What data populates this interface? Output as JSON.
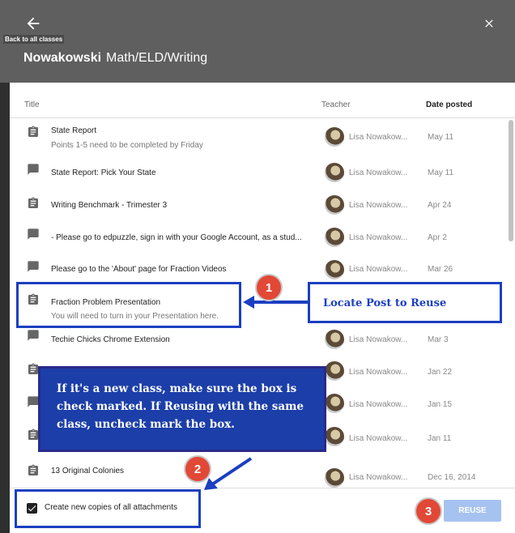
{
  "header": {
    "back_tooltip": "Back to all classes",
    "teacher_name": "Nowakowski",
    "class_name": "Math/ELD/Writing"
  },
  "columns": {
    "title": "Title",
    "teacher": "Teacher",
    "date": "Date posted"
  },
  "rows": [
    {
      "icon": "assignment-icon",
      "title": "State Report",
      "subtitle": "Points 1-5 need to be completed by Friday",
      "teacher": "Lisa Nowakow...",
      "date": "May 11"
    },
    {
      "icon": "announcement-icon",
      "title": "State Report: Pick Your State",
      "subtitle": "",
      "teacher": "Lisa Nowakow...",
      "date": "May 11"
    },
    {
      "icon": "assignment-icon",
      "title": "Writing Benchmark - Trimester 3",
      "subtitle": "",
      "teacher": "Lisa Nowakow...",
      "date": "Apr 24"
    },
    {
      "icon": "announcement-icon",
      "title": "- Please go to edpuzzle, sign in with your Google Account, as a stud...",
      "subtitle": "",
      "teacher": "Lisa Nowakow...",
      "date": "Apr 2"
    },
    {
      "icon": "announcement-icon",
      "title": "Please go to the 'About' page for Fraction Videos",
      "subtitle": "",
      "teacher": "Lisa Nowakow...",
      "date": "Mar 26"
    },
    {
      "icon": "assignment-icon",
      "title": "Fraction Problem Presentation",
      "subtitle": "You will need to turn in your Presentation here.",
      "teacher": "",
      "date": ""
    },
    {
      "icon": "announcement-icon",
      "title": "Techie Chicks Chrome Extension",
      "subtitle": "",
      "teacher": "Lisa Nowakow...",
      "date": "Mar 3"
    },
    {
      "icon": "assignment-icon",
      "title": "",
      "subtitle": "",
      "teacher": "Lisa Nowakow...",
      "date": "Jan 22"
    },
    {
      "icon": "announcement-icon",
      "title": "",
      "subtitle": "",
      "teacher": "Lisa Nowakow...",
      "date": "Jan 15"
    },
    {
      "icon": "assignment-icon",
      "title": "",
      "subtitle": "",
      "teacher": "Lisa Nowakow...",
      "date": "Jan 11"
    },
    {
      "icon": "assignment-icon",
      "title": "13 Original Colonies",
      "subtitle": "",
      "teacher": "Lisa Nowakow...",
      "date": "Dec 16, 2014"
    }
  ],
  "footer": {
    "checkbox_checked": true,
    "checkbox_label": "Create new copies of all attachments",
    "reuse_label": "REUSE"
  },
  "annotations": {
    "locate_text": "Locate Post to Reuse",
    "instruction_text": "If it's a new class, make sure the box is check marked. If Reusing with the same class, uncheck mark the box.",
    "badges": [
      "1",
      "2",
      "3"
    ]
  },
  "colors": {
    "header": "#5f5f5f",
    "callout_border": "#1b3fc0",
    "callout_fill": "#1c3ea8",
    "badge": "#e24836",
    "reuse_button": "#a6c2f0"
  }
}
